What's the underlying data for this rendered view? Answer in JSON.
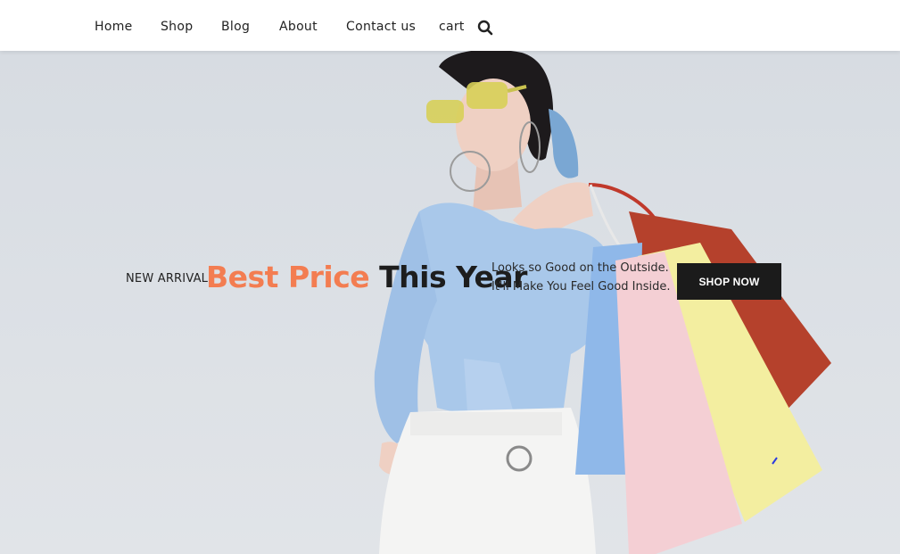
{
  "nav": {
    "items": [
      {
        "label": "Home"
      },
      {
        "label": "Shop"
      },
      {
        "label": "Blog"
      },
      {
        "label": "About"
      },
      {
        "label": "Contact us"
      },
      {
        "label": "cart"
      }
    ],
    "search_icon": "search-icon"
  },
  "hero": {
    "kicker": "NEW ARRIVAL",
    "headline_accent": "Best Price",
    "headline_rest": "This Year",
    "tagline_line1": "Looks so Good on the Outside.",
    "tagline_line2": "It'll Make You Feel Good Inside.",
    "cta_label": "SHOP NOW"
  },
  "colors": {
    "accent": "#f37d51",
    "button_bg": "#1b1b1b",
    "hero_bg": "#d9dee3"
  }
}
